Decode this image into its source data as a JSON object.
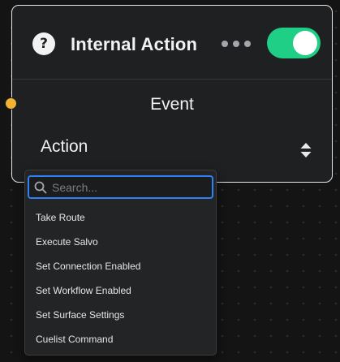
{
  "node": {
    "help_glyph": "?",
    "title": "Internal Action",
    "enabled": true,
    "event_label": "Event",
    "action_label": "Action"
  },
  "dropdown": {
    "search_placeholder": "Search...",
    "search_value": "",
    "items": [
      "Take Route",
      "Execute Salvo",
      "Set Connection Enabled",
      "Set Workflow Enabled",
      "Set Surface Settings",
      "Cuelist Command"
    ]
  },
  "colors": {
    "toggle_on": "#1fcf86",
    "port": "#f2b233",
    "search_focus": "#2f81f7"
  },
  "icons": [
    "help-icon",
    "more-icon",
    "toggle-switch",
    "up-down-icon",
    "search-icon",
    "input-port"
  ]
}
